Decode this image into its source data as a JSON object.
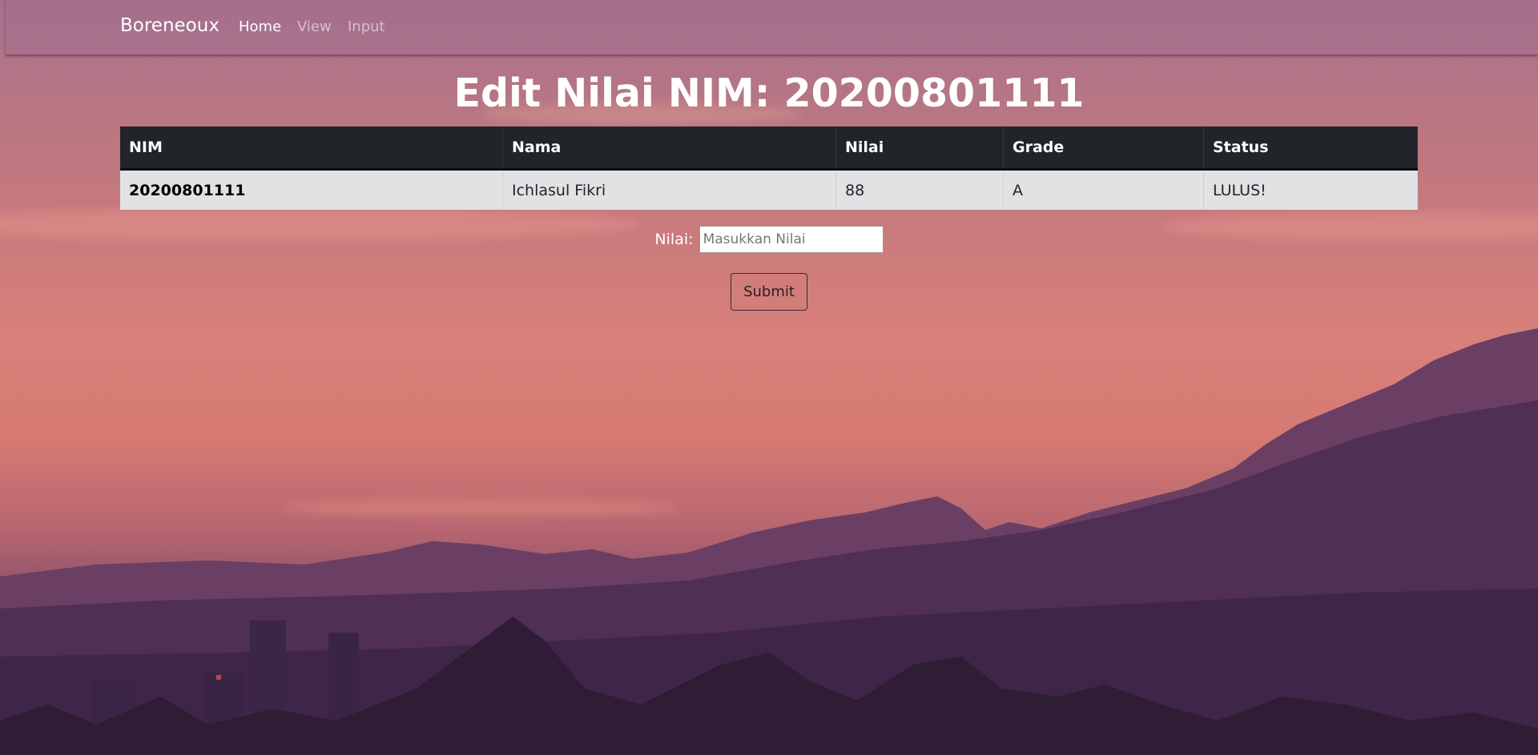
{
  "navbar": {
    "brand": "Boreneoux",
    "links": [
      {
        "label": "Home",
        "active": true
      },
      {
        "label": "View",
        "active": false
      },
      {
        "label": "Input",
        "active": false
      }
    ]
  },
  "page": {
    "title": "Edit Nilai NIM: 20200801111"
  },
  "table": {
    "headers": [
      "NIM",
      "Nama",
      "Nilai",
      "Grade",
      "Status"
    ],
    "rows": [
      {
        "nim": "20200801111",
        "nama": "Ichlasul Fikri",
        "nilai": "88",
        "grade": "A",
        "status": "LULUS!"
      }
    ]
  },
  "form": {
    "label": "Nilai:",
    "placeholder": "Masukkan Nilai",
    "value": "",
    "submit_label": "Submit"
  },
  "colors": {
    "table_header_bg": "#212529",
    "table_row_bg": "#e1e2e4",
    "sky_top": "#a7718f",
    "sky_mid": "#d9807a",
    "mountain": "#4a2c4e"
  }
}
